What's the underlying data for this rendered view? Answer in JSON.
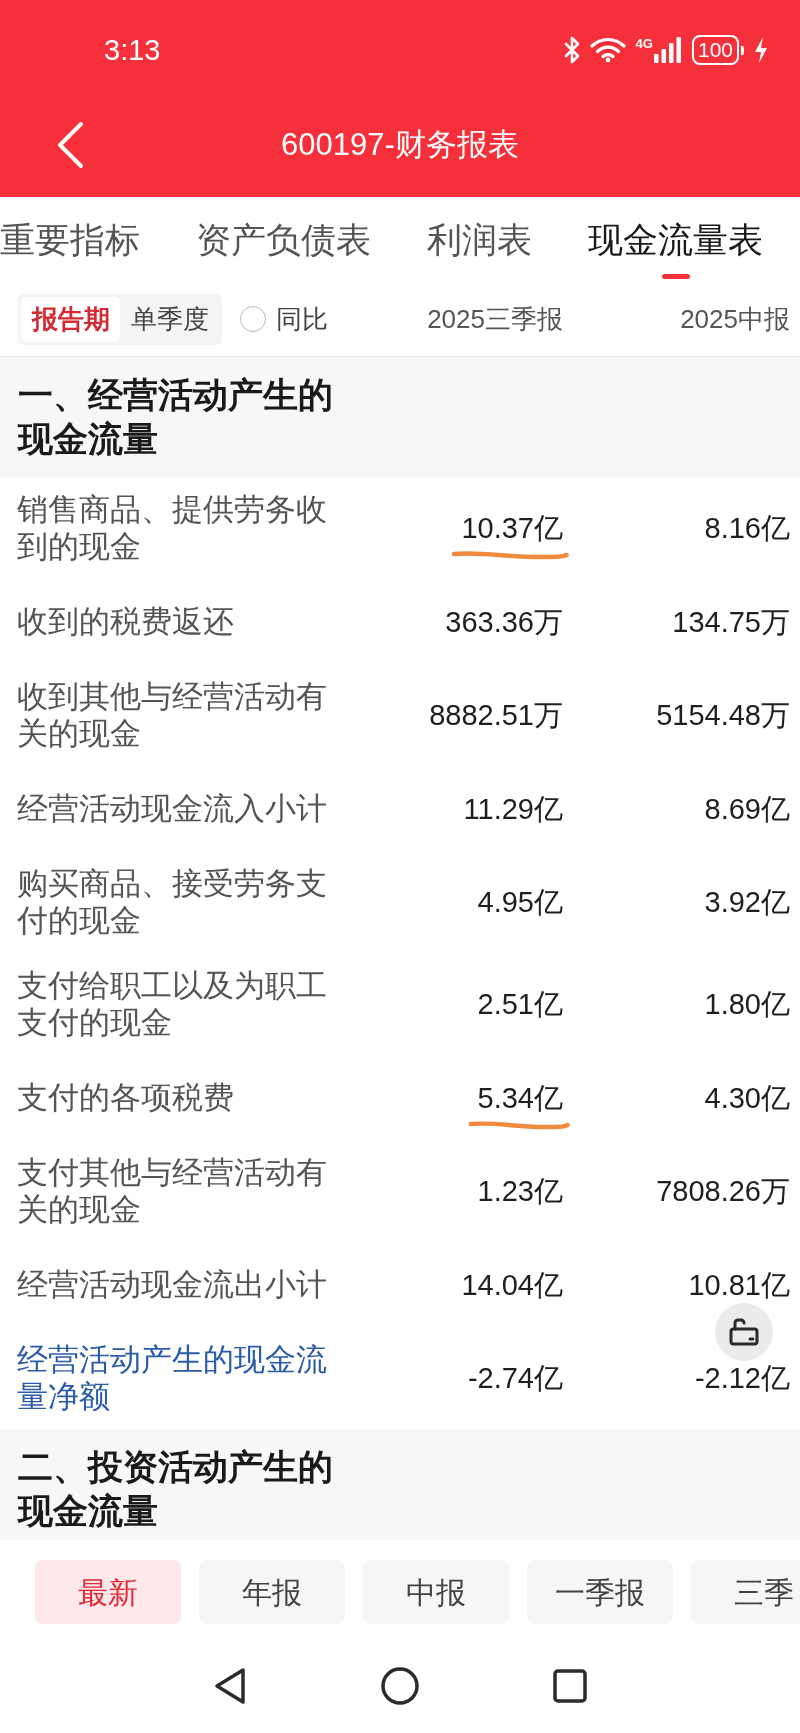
{
  "status_bar": {
    "time": "3:13",
    "network": "4G",
    "battery": "100",
    "charging": true
  },
  "header": {
    "title": "600197-财务报表"
  },
  "tabs": [
    {
      "label": "重要指标",
      "selected": false
    },
    {
      "label": "资产负债表",
      "selected": false
    },
    {
      "label": "利润表",
      "selected": false
    },
    {
      "label": "现金流量表",
      "selected": true
    }
  ],
  "filter_bar": {
    "modes": [
      {
        "label": "报告期",
        "selected": true
      },
      {
        "label": "单季度",
        "selected": false
      }
    ],
    "compare": {
      "label": "同比",
      "checked": false
    },
    "columns": [
      "2025三季报",
      "2025中报"
    ]
  },
  "sections": [
    {
      "title": "一、经营活动产生的现金流量",
      "rows": [
        {
          "kind": "item",
          "label": "销售商品、提供劳务收到的现金",
          "values": [
            "10.37亿",
            "8.16亿"
          ],
          "marked": true
        },
        {
          "kind": "item",
          "label": "收到的税费返还",
          "values": [
            "363.36万",
            "134.75万"
          ],
          "marked": false
        },
        {
          "kind": "item",
          "label": "收到其他与经营活动有关的现金",
          "values": [
            "8882.51万",
            "5154.48万"
          ],
          "marked": false
        },
        {
          "kind": "item",
          "label": "经营活动现金流入小计",
          "values": [
            "11.29亿",
            "8.69亿"
          ],
          "marked": false
        },
        {
          "kind": "item",
          "label": "购买商品、接受劳务支付的现金",
          "values": [
            "4.95亿",
            "3.92亿"
          ],
          "marked": false
        },
        {
          "kind": "item",
          "label": "支付给职工以及为职工支付的现金",
          "values": [
            "2.51亿",
            "1.80亿"
          ],
          "marked": false
        },
        {
          "kind": "item",
          "label": "支付的各项税费",
          "values": [
            "5.34亿",
            "4.30亿"
          ],
          "marked": true
        },
        {
          "kind": "item",
          "label": "支付其他与经营活动有关的现金",
          "values": [
            "1.23亿",
            "7808.26万"
          ],
          "marked": false
        },
        {
          "kind": "item",
          "label": "经营活动现金流出小计",
          "values": [
            "14.04亿",
            "10.81亿"
          ],
          "marked": false
        },
        {
          "kind": "total",
          "label": "经营活动产生的现金流量净额",
          "values": [
            "-2.74亿",
            "-2.12亿"
          ],
          "marked": false
        }
      ]
    },
    {
      "title": "二、投资活动产生的现金流量"
    }
  ],
  "period_buttons": [
    {
      "label": "最新",
      "selected": true
    },
    {
      "label": "年报",
      "selected": false
    },
    {
      "label": "中报",
      "selected": false
    },
    {
      "label": "一季报",
      "selected": false
    },
    {
      "label": "三季",
      "selected": false
    }
  ]
}
